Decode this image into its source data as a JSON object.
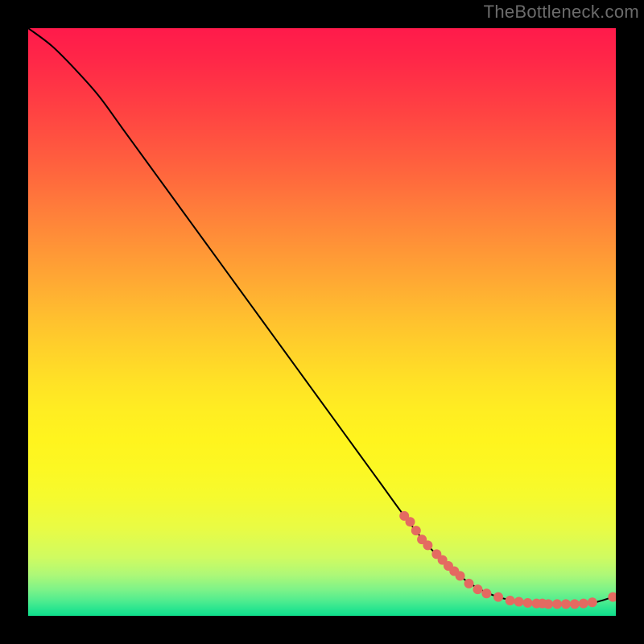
{
  "attribution": "TheBottleneck.com",
  "chart_data": {
    "type": "line",
    "title": "",
    "xlabel": "",
    "ylabel": "",
    "xlim": [
      0,
      100
    ],
    "ylim": [
      0,
      100
    ],
    "grid": false,
    "legend": false,
    "curve": {
      "x": [
        0,
        4,
        8,
        12,
        16,
        20,
        24,
        28,
        32,
        36,
        40,
        44,
        48,
        52,
        56,
        60,
        64,
        68,
        72,
        76,
        80,
        84,
        88,
        92,
        96,
        99.5
      ],
      "y": [
        100,
        97,
        93,
        88.5,
        83,
        77.5,
        72,
        66.5,
        61,
        55.5,
        50,
        44.5,
        39,
        33.5,
        28,
        22.5,
        17,
        12,
        8,
        5,
        3.2,
        2.4,
        2.1,
        2.0,
        2.2,
        3.2
      ]
    },
    "highlight_points": [
      {
        "x": 64.0,
        "y": 17.0
      },
      {
        "x": 65.0,
        "y": 16.0
      },
      {
        "x": 66.0,
        "y": 14.5
      },
      {
        "x": 67.0,
        "y": 13.0
      },
      {
        "x": 68.0,
        "y": 12.0
      },
      {
        "x": 69.5,
        "y": 10.5
      },
      {
        "x": 70.5,
        "y": 9.5
      },
      {
        "x": 71.5,
        "y": 8.5
      },
      {
        "x": 72.5,
        "y": 7.6
      },
      {
        "x": 73.5,
        "y": 6.8
      },
      {
        "x": 75.0,
        "y": 5.5
      },
      {
        "x": 76.5,
        "y": 4.5
      },
      {
        "x": 78.0,
        "y": 3.8
      },
      {
        "x": 80.0,
        "y": 3.2
      },
      {
        "x": 82.0,
        "y": 2.6
      },
      {
        "x": 83.5,
        "y": 2.4
      },
      {
        "x": 85.0,
        "y": 2.2
      },
      {
        "x": 86.5,
        "y": 2.1
      },
      {
        "x": 87.5,
        "y": 2.1
      },
      {
        "x": 88.5,
        "y": 2.0
      },
      {
        "x": 90.0,
        "y": 2.0
      },
      {
        "x": 91.5,
        "y": 2.0
      },
      {
        "x": 93.0,
        "y": 2.0
      },
      {
        "x": 94.5,
        "y": 2.1
      },
      {
        "x": 96.0,
        "y": 2.3
      },
      {
        "x": 99.5,
        "y": 3.2
      }
    ],
    "gradient_stops": [
      {
        "offset": 0.0,
        "color": "#ff1a4b"
      },
      {
        "offset": 0.05,
        "color": "#ff2648"
      },
      {
        "offset": 0.1,
        "color": "#ff3545"
      },
      {
        "offset": 0.15,
        "color": "#ff4542"
      },
      {
        "offset": 0.2,
        "color": "#ff5640"
      },
      {
        "offset": 0.25,
        "color": "#ff673d"
      },
      {
        "offset": 0.3,
        "color": "#ff7a3b"
      },
      {
        "offset": 0.35,
        "color": "#ff8c38"
      },
      {
        "offset": 0.4,
        "color": "#ff9e35"
      },
      {
        "offset": 0.45,
        "color": "#ffb032"
      },
      {
        "offset": 0.5,
        "color": "#ffc22e"
      },
      {
        "offset": 0.55,
        "color": "#ffd22a"
      },
      {
        "offset": 0.6,
        "color": "#ffe126"
      },
      {
        "offset": 0.65,
        "color": "#ffed22"
      },
      {
        "offset": 0.7,
        "color": "#fff41e"
      },
      {
        "offset": 0.75,
        "color": "#fcf823"
      },
      {
        "offset": 0.8,
        "color": "#f5fa2f"
      },
      {
        "offset": 0.85,
        "color": "#e9fb44"
      },
      {
        "offset": 0.9,
        "color": "#d0fb60"
      },
      {
        "offset": 0.93,
        "color": "#aef877"
      },
      {
        "offset": 0.955,
        "color": "#7ef388"
      },
      {
        "offset": 0.975,
        "color": "#4eec8f"
      },
      {
        "offset": 0.99,
        "color": "#25e48f"
      },
      {
        "offset": 1.0,
        "color": "#0fde8c"
      }
    ],
    "marker_color": "#e46a61",
    "curve_color": "#000000",
    "green_band_approx_y_fraction_from_top": 0.96
  }
}
